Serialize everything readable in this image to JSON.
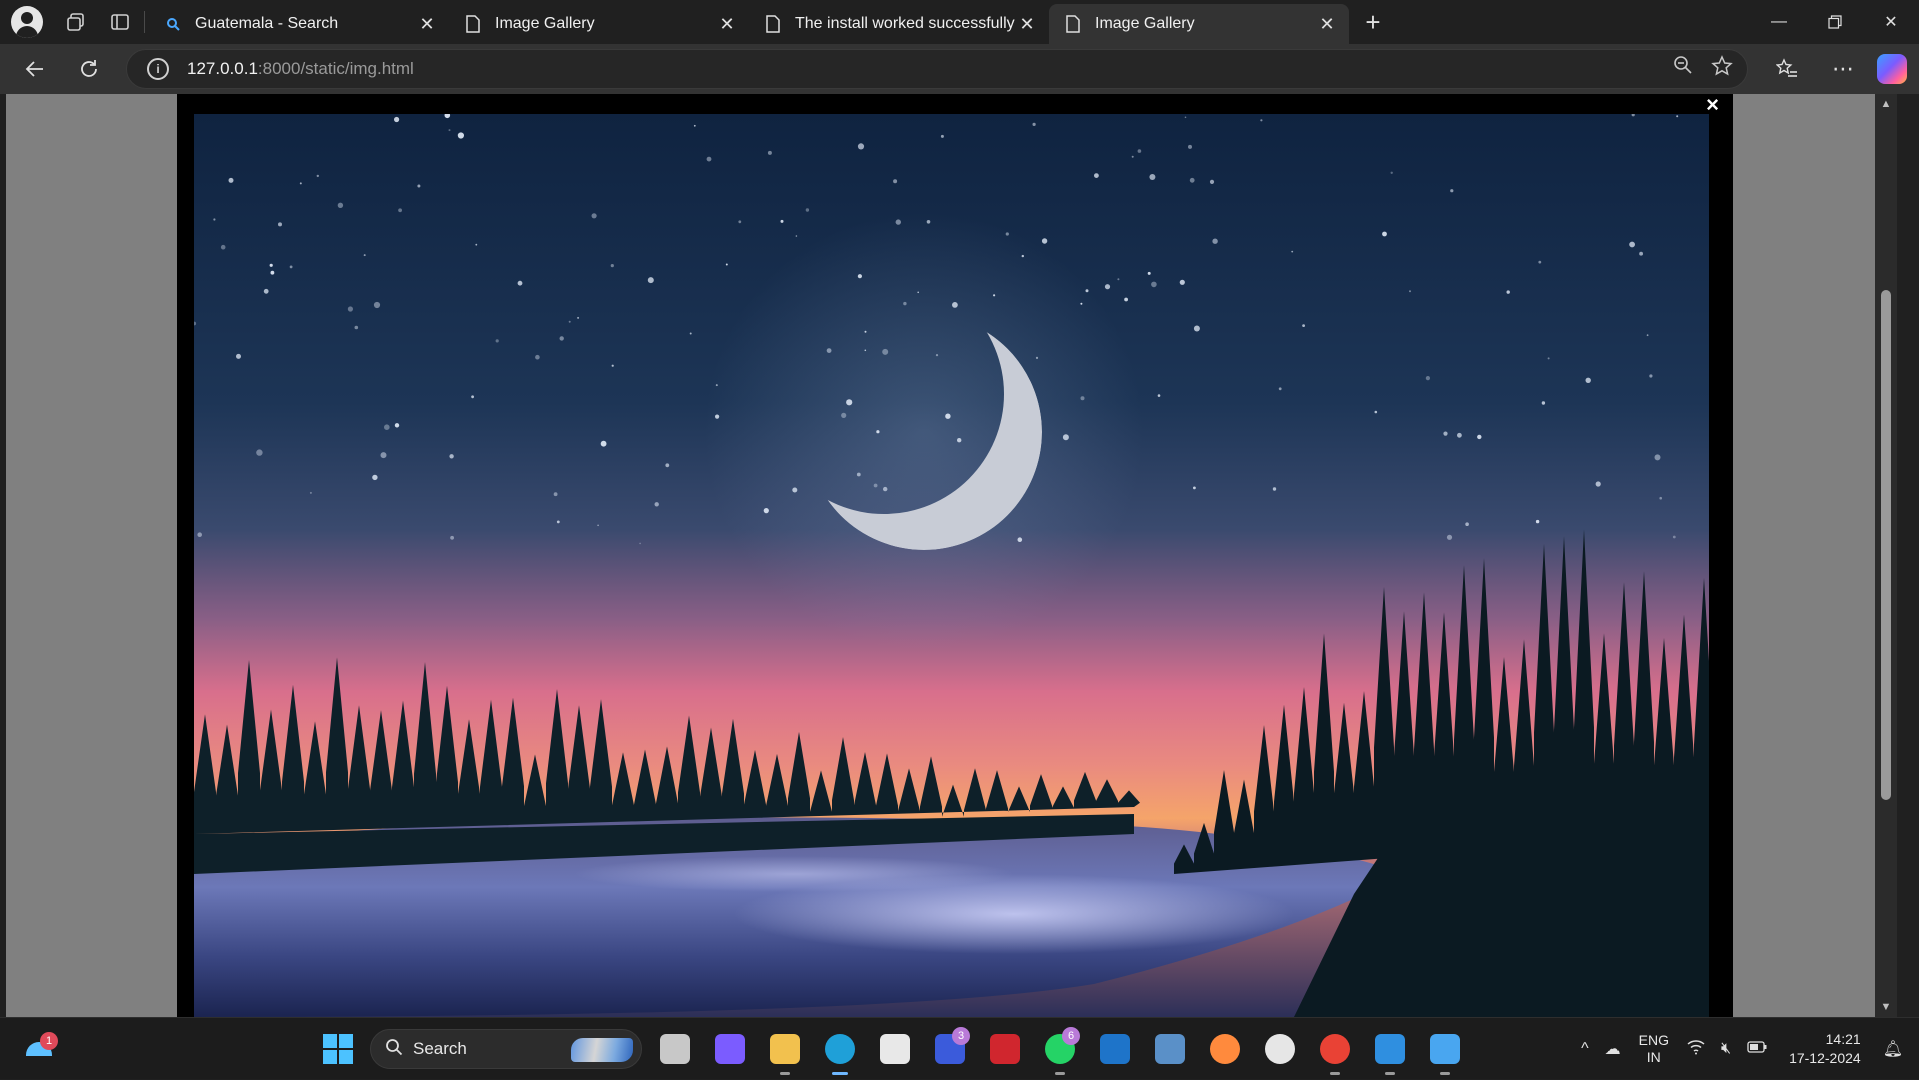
{
  "browser": {
    "tabs": [
      {
        "title": "Guatemala - Search",
        "icon": "search-icon",
        "active": false
      },
      {
        "title": "Image Gallery",
        "icon": "page-icon",
        "active": false
      },
      {
        "title": "The install worked successfully! C",
        "icon": "page-icon",
        "active": false
      },
      {
        "title": "Image Gallery",
        "icon": "page-icon",
        "active": true
      }
    ],
    "address": {
      "host": "127.0.0.1",
      "path": ":8000/static/img.html"
    },
    "window_controls": [
      "minimize",
      "restore",
      "close"
    ]
  },
  "page": {
    "modal_close": "×",
    "image_description_colors": {
      "sky_top": "#0f2340",
      "sky_mid": "#3a4a6e",
      "horizon": "#e0708a",
      "glow": "#f5a46a",
      "water": "#6c78b8",
      "trees": "#0d1c24"
    }
  },
  "taskbar": {
    "weather_badge": "1",
    "search_label": "Search",
    "apps": [
      {
        "name": "task-view",
        "color": "#c8c8c8",
        "badge": ""
      },
      {
        "name": "copilot",
        "color": "#7b5cff",
        "badge": ""
      },
      {
        "name": "file-explorer",
        "color": "#f2c14e",
        "badge": ""
      },
      {
        "name": "edge",
        "color": "#1fa0d8",
        "badge": "",
        "active": true
      },
      {
        "name": "microsoft-store",
        "color": "#e8e8e8",
        "badge": ""
      },
      {
        "name": "teams-l",
        "color": "#3b5bdb",
        "badge": "3"
      },
      {
        "name": "mcafee",
        "color": "#d0262e",
        "badge": ""
      },
      {
        "name": "whatsapp",
        "color": "#25d366",
        "badge": "6"
      },
      {
        "name": "app-blue-window",
        "color": "#1e74c9",
        "badge": ""
      },
      {
        "name": "app-globe-wave",
        "color": "#5a90c8",
        "badge": ""
      },
      {
        "name": "firefox",
        "color": "#ff8a3d",
        "badge": ""
      },
      {
        "name": "chatgpt",
        "color": "#e6e6e6",
        "badge": ""
      },
      {
        "name": "chrome",
        "color": "#e94235",
        "badge": ""
      },
      {
        "name": "vscode",
        "color": "#2f8fe0",
        "badge": ""
      },
      {
        "name": "photos",
        "color": "#49a6f0",
        "badge": ""
      }
    ],
    "tray": {
      "lang_top": "ENG",
      "lang_bottom": "IN",
      "time": "14:21",
      "date": "17-12-2024"
    }
  }
}
